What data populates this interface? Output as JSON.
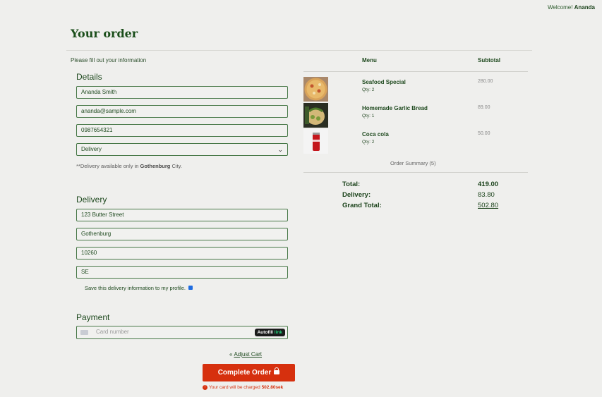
{
  "header": {
    "welcome_prefix": "Welcome!",
    "user_name": "Ananda"
  },
  "page_title": "Your order",
  "form": {
    "fill_info": "Please fill out your information",
    "details_title": "Details",
    "name": "Ananda Smith",
    "email": "ananda@sample.com",
    "phone": "0987654321",
    "delivery_method": "Delivery",
    "note_prefix": "**Delivery available only in",
    "note_city": "Gothenburg",
    "note_suffix": "City.",
    "delivery_title": "Delivery",
    "street": "123 Butter Street",
    "city": "Gothenburg",
    "postal": "10260",
    "country": "SE",
    "save_label": "Save this delivery information to my profile.",
    "payment_title": "Payment",
    "card_placeholder": "Card number",
    "autofill_a": "Autofill",
    "autofill_b": "link"
  },
  "actions": {
    "adjust_cart_chev": "«",
    "adjust_cart": "Adjust Cart",
    "complete_label": "Complete Order",
    "charge_prefix": "Your card will be charged",
    "charge_amount": "502.80sek",
    "err_icon": "!"
  },
  "cart": {
    "menu_header": "Menu",
    "subtotal_header": "Subtotal",
    "items": [
      {
        "name": "Seafood Special",
        "qty": "Qty: 2",
        "subtotal": "280.00",
        "icon": "pizza"
      },
      {
        "name": "Homemade Garlic Bread",
        "qty": "Qty: 1",
        "subtotal": "89.00",
        "icon": "garlic-bread"
      },
      {
        "name": "Coca cola",
        "qty": "Qty: 2",
        "subtotal": "50.00",
        "icon": "cola-can"
      }
    ],
    "order_summary": "Order Summary (5)",
    "total_label": "Total:",
    "total_value": "419.00",
    "delivery_label": "Delivery:",
    "delivery_value": "83.80",
    "grand_label": "Grand Total:",
    "grand_value": "502.80"
  },
  "colors": {
    "brand_green": "#1f4a1f",
    "accent_red": "#d6300e",
    "link_green": "#22d17a"
  }
}
